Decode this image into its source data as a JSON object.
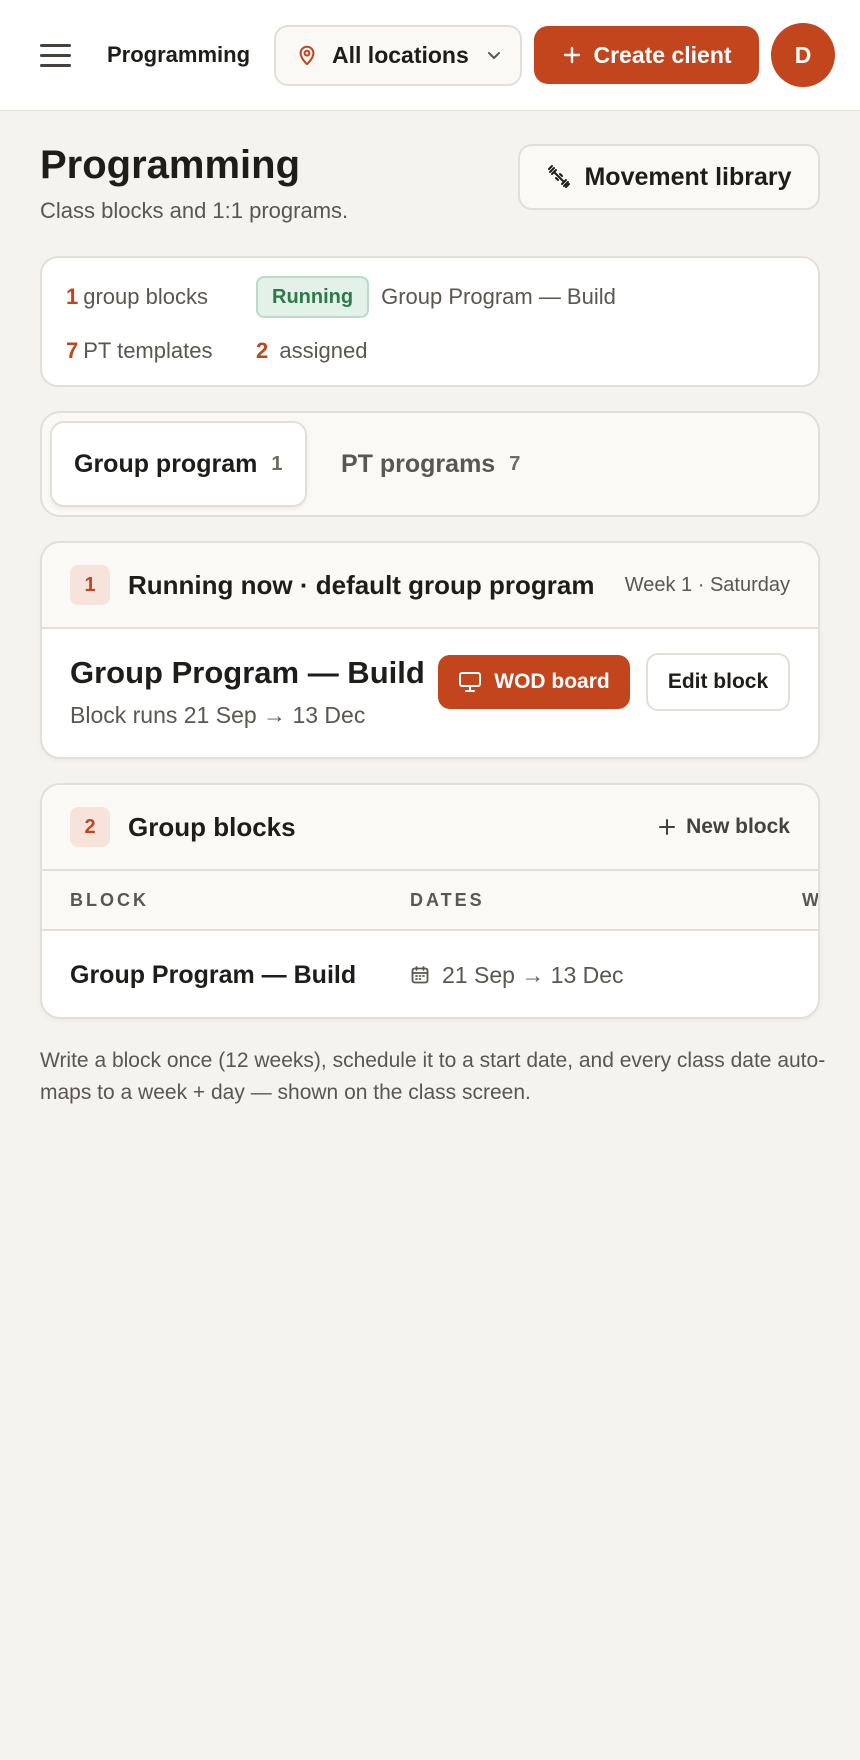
{
  "topbar": {
    "title": "Programming",
    "location_label": "All locations",
    "create_label": "Create client",
    "avatar_initial": "D"
  },
  "page": {
    "title": "Programming",
    "subtitle": "Class blocks and 1:1 programs.",
    "movement_library_label": "Movement library"
  },
  "summary": {
    "group_blocks_count": "1",
    "group_blocks_label": "group blocks",
    "running_badge": "Running",
    "running_name": "Group Program — Build",
    "pt_templates_count": "7",
    "pt_templates_label": "PT templates",
    "assigned_count": "2",
    "assigned_label": "assigned"
  },
  "tabs": [
    {
      "label": "Group program",
      "count": "1",
      "active": true
    },
    {
      "label": "PT programs",
      "count": "7",
      "active": false
    }
  ],
  "running_card": {
    "step": "1",
    "title": "Running now · default group program",
    "meta": "Week 1 · Saturday",
    "block_name": "Group Program — Build",
    "block_runs": "Block runs 21 Sep → 13 Dec",
    "wod_label": "WOD board",
    "edit_label": "Edit block"
  },
  "blocks_card": {
    "step": "2",
    "title": "Group blocks",
    "new_label": "New block",
    "columns": [
      "BLOCK",
      "DATES",
      "W"
    ],
    "rows": [
      {
        "block": "Group Program — Build",
        "dates": "21 Sep → 13 Dec"
      }
    ]
  },
  "footnote": "Write a block once (12 weeks), schedule it to a start date, and every class date auto-maps to a week + day — shown on the class screen.",
  "colors": {
    "accent": "#c2451e",
    "background": "#f5f3ef",
    "running_green": "#2c7a4a"
  }
}
